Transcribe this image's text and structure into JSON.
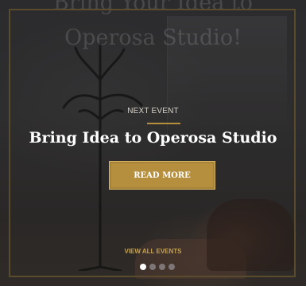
{
  "hero": {
    "background_title_line1": "Bring Your Idea to",
    "background_title_line2": "Operosa Studio!",
    "eyebrow": "NEXT EVENT",
    "title": "Bring Idea to Operosa Studio",
    "cta_label": "READ MORE",
    "view_all_label": "VIEW ALL EVENTS"
  },
  "carousel": {
    "slide_count": 4,
    "active_index": 0
  },
  "colors": {
    "accent_gold": "#b58f3e",
    "link_gold": "#c6a24f",
    "background": "#2b2b2d"
  }
}
